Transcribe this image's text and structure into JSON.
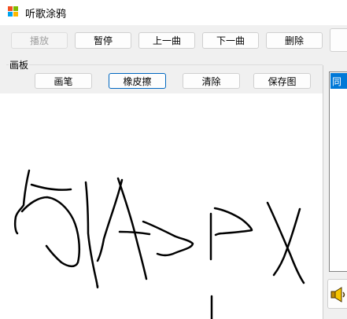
{
  "window": {
    "title": "听歌涂鸦"
  },
  "toolbar": {
    "play_label": "播放",
    "pause_label": "暂停",
    "prev_label": "上一曲",
    "next_label": "下一曲",
    "delete_label": "删除"
  },
  "drawing_panel": {
    "group_title": "画板",
    "pen_label": "画笔",
    "eraser_label": "橡皮擦",
    "clear_label": "清除",
    "save_label": "保存图"
  },
  "playlist": {
    "items": [
      {
        "label": "同"
      }
    ]
  },
  "icons": {
    "app": "app-windows-icon",
    "speaker": "speaker-icon"
  },
  "colors": {
    "selection": "#0078d7",
    "focus_border": "#0067c0",
    "ink": "#000000"
  }
}
